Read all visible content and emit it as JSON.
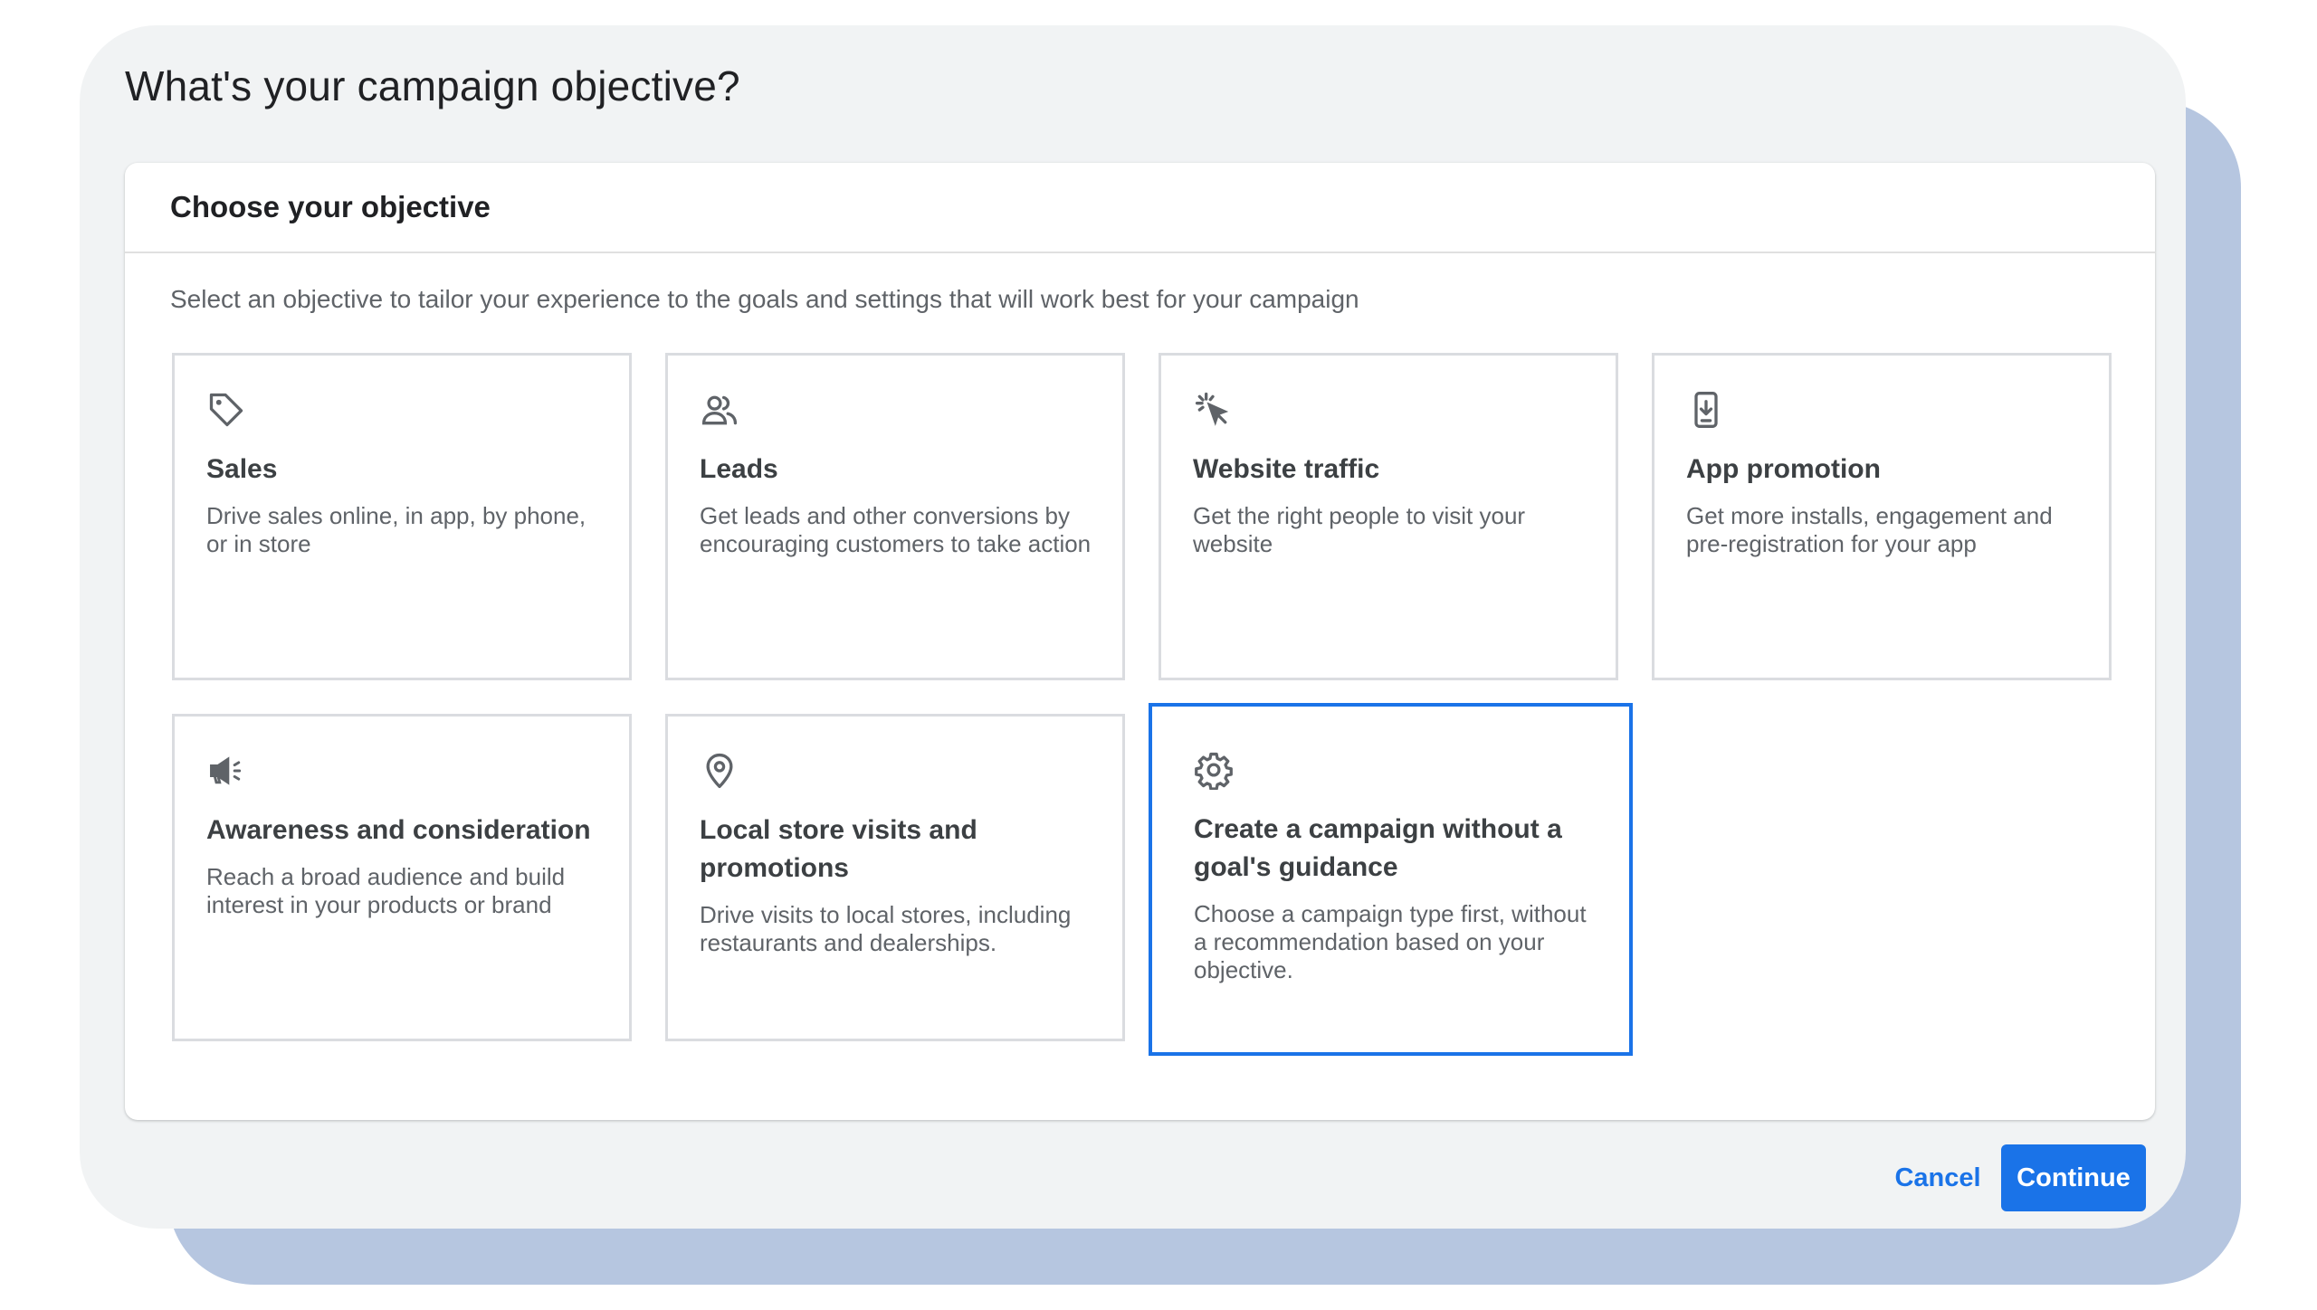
{
  "dialog": {
    "title": "What's your campaign objective?",
    "panel_title": "Choose your objective",
    "description": "Select an objective to tailor your experience to the goals and settings that will work best for your campaign"
  },
  "objectives": [
    {
      "title": "Sales",
      "description": "Drive sales online, in app, by phone, or in store",
      "icon": "tag-icon",
      "selected": false
    },
    {
      "title": "Leads",
      "description": "Get leads and other conversions by encouraging customers to take action",
      "icon": "people-icon",
      "selected": false
    },
    {
      "title": "Website traffic",
      "description": "Get the right people to visit your website",
      "icon": "cursor-click-icon",
      "selected": false
    },
    {
      "title": "App promotion",
      "description": "Get more installs, engagement and pre-registration for your app",
      "icon": "phone-download-icon",
      "selected": false
    },
    {
      "title": "Awareness and consideration",
      "description": "Reach a broad audience and build interest in your products or brand",
      "icon": "megaphone-icon",
      "selected": false
    },
    {
      "title": "Local store visits and promotions",
      "description": "Drive visits to local stores, including restaurants and dealerships.",
      "icon": "location-pin-icon",
      "selected": false
    },
    {
      "title": "Create a campaign without a goal's guidance",
      "description": "Choose a campaign type first, without a recommendation based on your objective.",
      "icon": "gear-icon",
      "selected": true
    }
  ],
  "footer": {
    "cancel_label": "Cancel",
    "continue_label": "Continue"
  },
  "colors": {
    "accent": "#1a73e8",
    "backdrop": "#b6c6e0",
    "dialog_bg": "#f1f3f4"
  }
}
